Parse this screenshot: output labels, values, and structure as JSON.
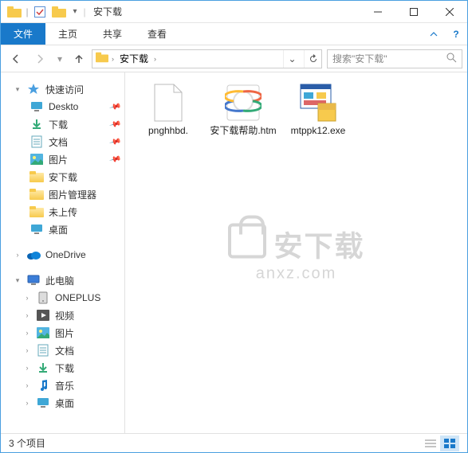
{
  "titlebar": {
    "title": "安下载"
  },
  "ribbon": {
    "file": "文件",
    "tabs": [
      "主页",
      "共享",
      "查看"
    ]
  },
  "navbar": {
    "breadcrumb": [
      "安下载"
    ],
    "search_placeholder": "搜索\"安下载\""
  },
  "sidebar": {
    "quick_access": "快速访问",
    "items": [
      {
        "label": "Deskto",
        "type": "desktop",
        "pinned": true
      },
      {
        "label": "下载",
        "type": "downloads",
        "pinned": true
      },
      {
        "label": "文档",
        "type": "documents",
        "pinned": true
      },
      {
        "label": "图片",
        "type": "pictures",
        "pinned": true
      },
      {
        "label": "安下载",
        "type": "folder",
        "pinned": false
      },
      {
        "label": "图片管理器",
        "type": "folder",
        "pinned": false
      },
      {
        "label": "未上传",
        "type": "folder",
        "pinned": false
      },
      {
        "label": "桌面",
        "type": "desktop2",
        "pinned": false
      }
    ],
    "onedrive": "OneDrive",
    "this_pc": "此电脑",
    "pc_items": [
      {
        "label": "ONEPLUS",
        "type": "device"
      },
      {
        "label": "视频",
        "type": "videos"
      },
      {
        "label": "图片",
        "type": "pictures"
      },
      {
        "label": "文档",
        "type": "documents"
      },
      {
        "label": "下载",
        "type": "downloads"
      },
      {
        "label": "音乐",
        "type": "music"
      },
      {
        "label": "桌面",
        "type": "desktop2"
      }
    ]
  },
  "files": [
    {
      "name": "pnghhbd.",
      "kind": "blank"
    },
    {
      "name": "安下载帮助.htm",
      "kind": "htm"
    },
    {
      "name": "mtppk12.exe",
      "kind": "exe"
    }
  ],
  "statusbar": {
    "text": "3 个项目"
  },
  "watermark": {
    "text": "安下载",
    "sub": "anxz.com"
  }
}
